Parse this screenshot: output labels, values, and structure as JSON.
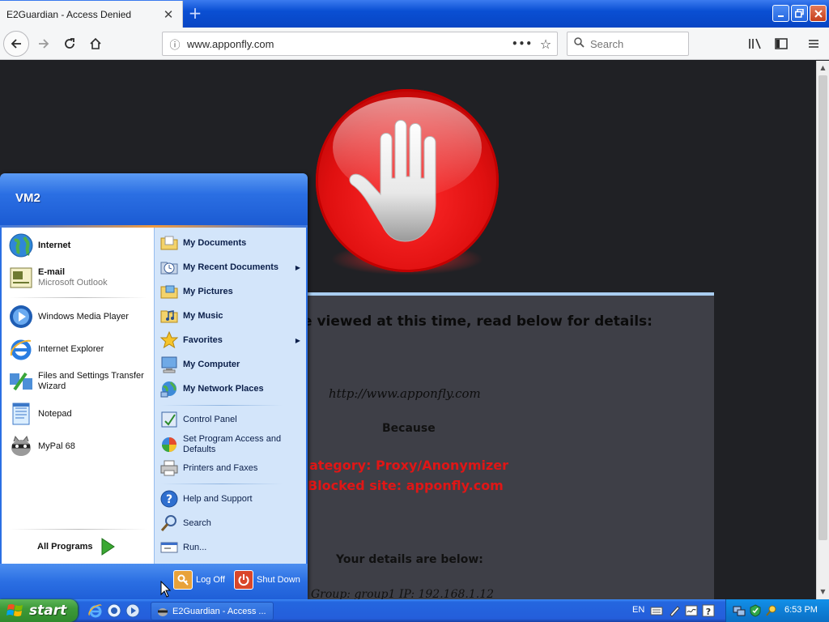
{
  "browser": {
    "tab_title": "E2Guardian - Access Denied",
    "tab_close": "✕",
    "new_tab": "+",
    "url": "www.apponfly.com",
    "search_placeholder": "Search"
  },
  "page": {
    "headline": "e viewed at this time, read below for details:",
    "blocked_url": "http://www.apponfly.com",
    "because": "Because",
    "reason_category": "ategory: Proxy/Anonymizer",
    "reason_site": "Blocked site: apponfly.com",
    "details_heading": "Your details are below:",
    "group_ip": "Group: group1   IP: 192.168.1.12"
  },
  "start_menu": {
    "user": "VM2",
    "left_items": [
      {
        "label": "Internet",
        "bold": true,
        "icon": "globe-icon"
      },
      {
        "label": "E-mail",
        "sub": "Microsoft Outlook",
        "bold": true,
        "icon": "outlook-icon"
      },
      {
        "label": "Windows Media Player",
        "icon": "media-player-icon"
      },
      {
        "label": "Internet Explorer",
        "icon": "ie-icon"
      },
      {
        "label": "Files and Settings Transfer Wizard",
        "icon": "transfer-wizard-icon"
      },
      {
        "label": "Notepad",
        "icon": "notepad-icon"
      },
      {
        "label": "MyPal 68",
        "icon": "mypal-icon"
      }
    ],
    "all_programs": "All Programs",
    "right_items": [
      {
        "label": "My Documents",
        "bold": true,
        "icon": "folder-documents-icon"
      },
      {
        "label": "My Recent Documents",
        "bold": true,
        "icon": "recent-documents-icon",
        "arrow": "▶"
      },
      {
        "label": "My Pictures",
        "bold": true,
        "icon": "folder-pictures-icon"
      },
      {
        "label": "My Music",
        "bold": true,
        "icon": "folder-music-icon"
      },
      {
        "label": "Favorites",
        "bold": true,
        "icon": "star-icon",
        "arrow": "▶"
      },
      {
        "label": "My Computer",
        "bold": true,
        "icon": "computer-icon"
      },
      {
        "label": "My Network Places",
        "bold": true,
        "icon": "network-icon"
      },
      {
        "label": "Control Panel",
        "icon": "control-panel-icon"
      },
      {
        "label": "Set Program Access and Defaults",
        "icon": "program-access-icon"
      },
      {
        "label": "Printers and Faxes",
        "icon": "printer-icon"
      },
      {
        "label": "Help and Support",
        "icon": "help-icon"
      },
      {
        "label": "Search",
        "icon": "search-icon"
      },
      {
        "label": "Run...",
        "icon": "run-icon"
      }
    ],
    "log_off": "Log Off",
    "shut_down": "Shut Down"
  },
  "taskbar": {
    "start_label": "start",
    "task_label": "E2Guardian - Access ...",
    "language": "EN",
    "time": "6:53 PM"
  },
  "colors": {
    "xp_blue": "#245edb",
    "start_green": "#3d9a38",
    "stop_red": "#e01010",
    "blocked_text_red": "#e01616",
    "page_bg": "#202125",
    "panel_bg": "#3e3f47"
  }
}
